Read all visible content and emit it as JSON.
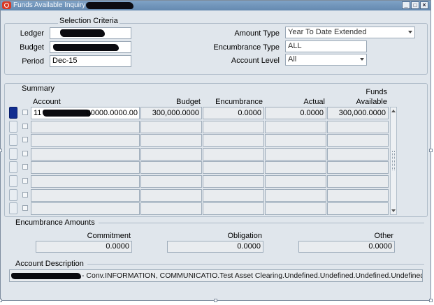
{
  "window": {
    "title": "Funds Available Inquiry",
    "controls": {
      "minimize": "_",
      "maximize": "□",
      "close": "×"
    }
  },
  "selection": {
    "heading": "Selection Criteria",
    "ledger_label": "Ledger",
    "budget_label": "Budget",
    "period_label": "Period",
    "period_value": "Dec-15",
    "amount_type_label": "Amount Type",
    "amount_type_value": "Year To Date Extended",
    "encumbrance_type_label": "Encumbrance Type",
    "encumbrance_type_value": "ALL",
    "account_level_label": "Account Level",
    "account_level_value": "All"
  },
  "summary": {
    "heading": "Summary",
    "columns": {
      "account": "Account",
      "budget": "Budget",
      "encumbrance": "Encumbrance",
      "actual": "Actual",
      "funds_line1": "Funds",
      "funds_line2": "Available"
    },
    "first_row": {
      "account_prefix": "11",
      "account_suffix": "00000.0000.00",
      "budget": "300,000.0000",
      "encumbrance": "0.0000",
      "actual": "0.0000",
      "funds_available": "300,000.0000"
    }
  },
  "encumbrance_amounts": {
    "heading": "Encumbrance Amounts",
    "commitment_label": "Commitment",
    "commitment_value": "0.0000",
    "obligation_label": "Obligation",
    "obligation_value": "0.0000",
    "other_label": "Other",
    "other_value": "0.0000"
  },
  "account_description": {
    "heading": "Account Description",
    "value": "- Conv.INFORMATION, COMMUNICATIO.Test Asset Clearing.Undefined.Undefined.Undefined.Undefined"
  },
  "icons": {
    "app_icon": "oracle-logo-icon",
    "dropdown": "chevron-down-icon",
    "scroll_up": "triangle-up-icon",
    "scroll_down": "triangle-down-icon"
  },
  "colors": {
    "titlebar": "#6f94ba",
    "window_bg": "#e0e6ec",
    "selected_row": "#112d90"
  }
}
